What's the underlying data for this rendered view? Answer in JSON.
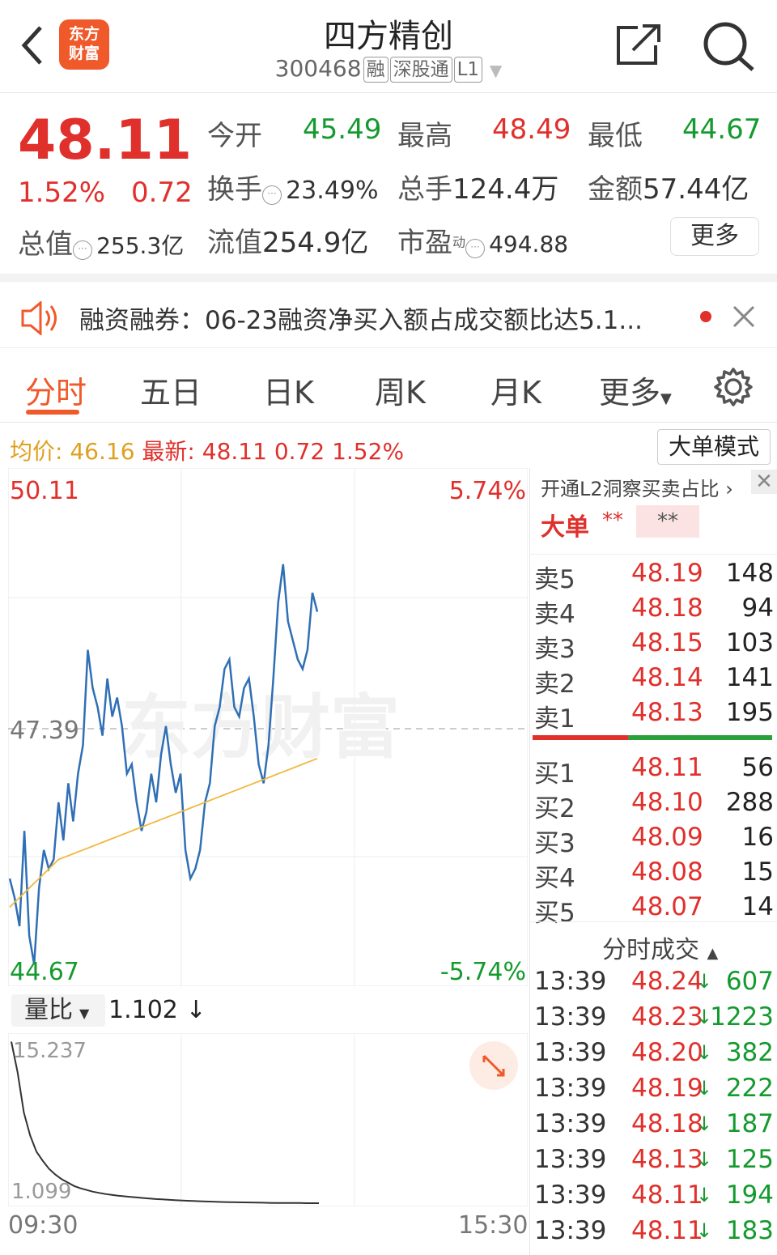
{
  "header": {
    "back_icon": "chevron-left-icon",
    "logo_line1": "东方",
    "logo_line2": "财富",
    "stock_name": "四方精创",
    "stock_code": "300468",
    "tags": [
      "融",
      "深股通",
      "L1"
    ],
    "share_icon": "share-icon",
    "search_icon": "search-icon"
  },
  "quote": {
    "price": "48.11",
    "change_pct": "1.52%",
    "change": "0.72",
    "open_label": "今开",
    "open": "45.49",
    "high_label": "最高",
    "high": "48.49",
    "low_label": "最低",
    "low": "44.67",
    "turnover_label": "换手",
    "turnover": "23.49%",
    "volume_label": "总手",
    "volume": "124.4万",
    "amount_label": "金额",
    "amount": "57.44亿",
    "mktcap_label": "总值",
    "mktcap": "255.3亿",
    "float_label": "流值",
    "float_cap": "254.9亿",
    "pe_label": "市盈",
    "pe_sup": "动",
    "pe": "494.88",
    "more_button": "更多",
    "colors": {
      "up": "#e0302c",
      "down": "#149a2e",
      "accent": "#f0592a"
    }
  },
  "notice": {
    "text": "融资融券：06-23融资净买入额占成交额比达5.1...",
    "close_icon": "close-icon"
  },
  "tabs": {
    "items": [
      "分时",
      "五日",
      "日K",
      "周K",
      "月K",
      "更多"
    ],
    "active": "分时"
  },
  "statline": {
    "avg_label": "均价:",
    "avg": "46.16",
    "latest_label": "最新:",
    "latest": "48.11",
    "change": "0.72",
    "change_pct": "1.52%",
    "big_order_button": "大单模式"
  },
  "chart_data": [
    {
      "type": "line",
      "title": "",
      "y_top_label": "50.11",
      "y_mid_label": "47.39",
      "y_bottom_label": "44.67",
      "pct_top_label": "5.74%",
      "pct_bottom_label": "-5.74%",
      "ylim": [
        44.67,
        50.11
      ],
      "reference": 47.39,
      "series": [
        {
          "name": "",
          "color": "#2f6fb5",
          "values": [
            45.8,
            45.6,
            45.3,
            46.3,
            45.2,
            44.9,
            45.7,
            46.1,
            45.9,
            46.0,
            46.6,
            46.2,
            46.8,
            46.4,
            46.9,
            47.2,
            48.2,
            47.8,
            47.6,
            47.3,
            47.9,
            47.5,
            47.7,
            47.4,
            46.9,
            47.0,
            46.6,
            46.3,
            46.5,
            46.9,
            46.6,
            47.1,
            47.4,
            47.0,
            46.7,
            46.9,
            46.1,
            45.8,
            45.9,
            46.1,
            46.6,
            46.8,
            47.4,
            47.6,
            48.0,
            48.1,
            47.6,
            47.5,
            47.8,
            47.9,
            47.5,
            47.0,
            46.8,
            47.2,
            47.9,
            48.7,
            49.1,
            48.5,
            48.3,
            48.1,
            48.0,
            48.2,
            48.8,
            48.6
          ]
        },
        {
          "name": "",
          "color": "#f0b840",
          "values": [
            45.5,
            45.55,
            45.6,
            45.65,
            45.7,
            45.75,
            45.8,
            45.85,
            45.9,
            45.95,
            46.0,
            46.02,
            46.04,
            46.06,
            46.08,
            46.1,
            46.12,
            46.14,
            46.16,
            46.18,
            46.2,
            46.22,
            46.24,
            46.26,
            46.28,
            46.3,
            46.32,
            46.34,
            46.36,
            46.38,
            46.4,
            46.42,
            46.44,
            46.46,
            46.48,
            46.5,
            46.52,
            46.54,
            46.56,
            46.58,
            46.6,
            46.62,
            46.64,
            46.66,
            46.68,
            46.7,
            46.72,
            46.74,
            46.76,
            46.78,
            46.8,
            46.82,
            46.84,
            46.86,
            46.88,
            46.9,
            46.92,
            46.94,
            46.96,
            46.98,
            47.0,
            47.02,
            47.04,
            47.06
          ]
        }
      ]
    },
    {
      "type": "line",
      "title": "",
      "selector_label": "量比",
      "current": "1.102",
      "y_top_label": "15.237",
      "y_bottom_label": "1.099",
      "ylim": [
        1.099,
        15.237
      ],
      "x_start_label": "09:30",
      "x_end_label": "15:30",
      "series": [
        {
          "name": "",
          "color": "#333333",
          "values": [
            15.2,
            12.5,
            9.0,
            7.0,
            5.6,
            4.8,
            4.1,
            3.6,
            3.2,
            2.9,
            2.6,
            2.4,
            2.25,
            2.1,
            2.0,
            1.9,
            1.82,
            1.75,
            1.7,
            1.65,
            1.6,
            1.55,
            1.5,
            1.46,
            1.43,
            1.4,
            1.37,
            1.34,
            1.31,
            1.29,
            1.27,
            1.25,
            1.23,
            1.21,
            1.2,
            1.19,
            1.18,
            1.17,
            1.16,
            1.15,
            1.14,
            1.13,
            1.12,
            1.12,
            1.11,
            1.11,
            1.11,
            1.1,
            1.1,
            1.1
          ]
        }
      ]
    }
  ],
  "watermark": "东方财富",
  "orderbook": {
    "header": "开通L2洞察买卖占比",
    "big_label": "大单",
    "big_val1": "**",
    "big_val2": "**",
    "sells": [
      {
        "name": "卖5",
        "price": "48.19",
        "vol": "148"
      },
      {
        "name": "卖4",
        "price": "48.18",
        "vol": "94"
      },
      {
        "name": "卖3",
        "price": "48.15",
        "vol": "103"
      },
      {
        "name": "卖2",
        "price": "48.14",
        "vol": "141"
      },
      {
        "name": "卖1",
        "price": "48.13",
        "vol": "195"
      }
    ],
    "buys": [
      {
        "name": "买1",
        "price": "48.11",
        "vol": "56"
      },
      {
        "name": "买2",
        "price": "48.10",
        "vol": "288"
      },
      {
        "name": "买3",
        "price": "48.09",
        "vol": "16"
      },
      {
        "name": "买4",
        "price": "48.08",
        "vol": "15"
      },
      {
        "name": "买5",
        "price": "48.07",
        "vol": "14"
      }
    ],
    "buy_sell_ratio": 0.4
  },
  "trades": {
    "header": "分时成交",
    "rows": [
      {
        "time": "13:39",
        "price": "48.24",
        "vol": "607"
      },
      {
        "time": "13:39",
        "price": "48.23",
        "vol": "1223"
      },
      {
        "time": "13:39",
        "price": "48.20",
        "vol": "382"
      },
      {
        "time": "13:39",
        "price": "48.19",
        "vol": "222"
      },
      {
        "time": "13:39",
        "price": "48.18",
        "vol": "187"
      },
      {
        "time": "13:39",
        "price": "48.13",
        "vol": "125"
      },
      {
        "time": "13:39",
        "price": "48.11",
        "vol": "194"
      },
      {
        "time": "13:39",
        "price": "48.11",
        "vol": "183"
      }
    ]
  }
}
